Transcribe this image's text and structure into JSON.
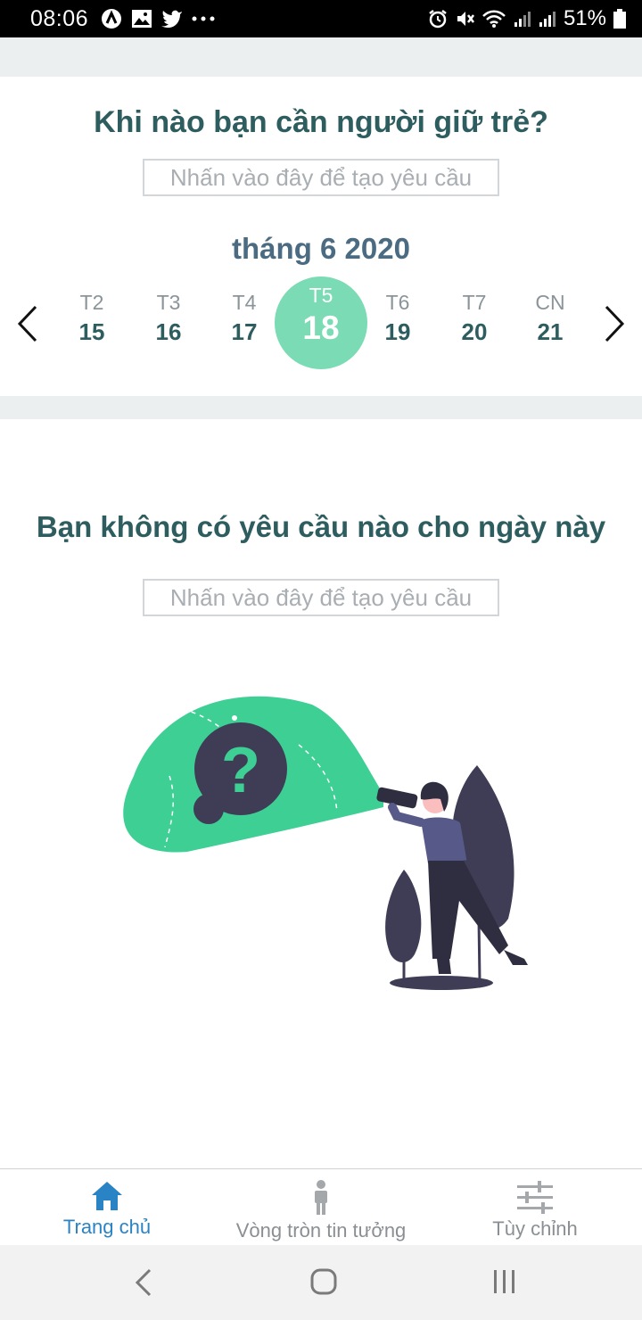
{
  "status_bar": {
    "time": "08:06",
    "battery": "51%",
    "left_icons": [
      "app-icon",
      "image-icon",
      "twitter-icon",
      "more-dots-icon"
    ],
    "right_icons": [
      "alarm-icon",
      "mute-icon",
      "wifi-icon",
      "signal-icon",
      "signal-icon",
      "battery-icon"
    ]
  },
  "top": {
    "question": "Khi nào bạn cần người giữ trẻ?",
    "input_placeholder": "Nhấn vào đây để tạo yêu cầu",
    "month": "tháng 6 2020",
    "prev_icon": "chevron-left-icon",
    "next_icon": "chevron-right-icon",
    "days": [
      {
        "name": "T2",
        "num": "15"
      },
      {
        "name": "T3",
        "num": "16"
      },
      {
        "name": "T4",
        "num": "17"
      },
      {
        "name": "T5",
        "num": "18"
      },
      {
        "name": "T6",
        "num": "19"
      },
      {
        "name": "T7",
        "num": "20"
      },
      {
        "name": "CN",
        "num": "21"
      }
    ]
  },
  "empty": {
    "title": "Bạn không có yêu cầu nào cho ngày này",
    "input_placeholder": "Nhấn vào đây để tạo yêu cầu"
  },
  "bottom_nav": {
    "home": "Trang chủ",
    "circle": "Vòng tròn tin tưởng",
    "settings": "Tùy chỉnh"
  },
  "colors": {
    "primary_text": "#2e5d5f",
    "accent": "#7bdbb4",
    "active_tab": "#2a83c5"
  }
}
